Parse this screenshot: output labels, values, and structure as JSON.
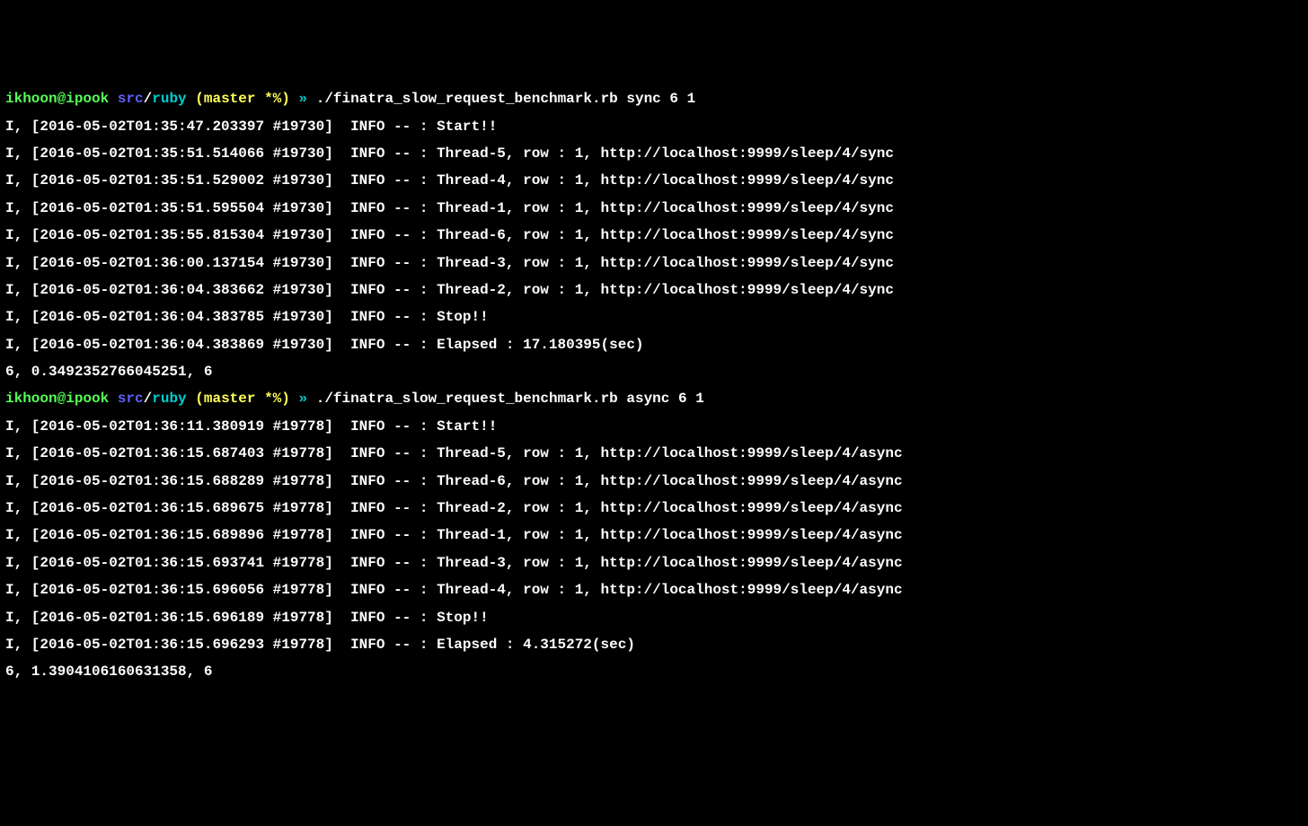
{
  "runs": [
    {
      "prompt": {
        "userhost": "ikhoon@ipook",
        "path_src": "src",
        "slash": "/",
        "path_ruby": "ruby",
        "branch": "(master *%)",
        "chevron": "»",
        "command": "./finatra_slow_request_benchmark.rb sync 6 1"
      },
      "lines": [
        "I, [2016-05-02T01:35:47.203397 #19730]  INFO -- : Start!!",
        "I, [2016-05-02T01:35:51.514066 #19730]  INFO -- : Thread-5, row : 1, http://localhost:9999/sleep/4/sync",
        "I, [2016-05-02T01:35:51.529002 #19730]  INFO -- : Thread-4, row : 1, http://localhost:9999/sleep/4/sync",
        "I, [2016-05-02T01:35:51.595504 #19730]  INFO -- : Thread-1, row : 1, http://localhost:9999/sleep/4/sync",
        "I, [2016-05-02T01:35:55.815304 #19730]  INFO -- : Thread-6, row : 1, http://localhost:9999/sleep/4/sync",
        "I, [2016-05-02T01:36:00.137154 #19730]  INFO -- : Thread-3, row : 1, http://localhost:9999/sleep/4/sync",
        "I, [2016-05-02T01:36:04.383662 #19730]  INFO -- : Thread-2, row : 1, http://localhost:9999/sleep/4/sync",
        "I, [2016-05-02T01:36:04.383785 #19730]  INFO -- : Stop!!",
        "I, [2016-05-02T01:36:04.383869 #19730]  INFO -- : Elapsed : 17.180395(sec)",
        "6, 0.3492352766045251, 6"
      ]
    },
    {
      "prompt": {
        "userhost": "ikhoon@ipook",
        "path_src": "src",
        "slash": "/",
        "path_ruby": "ruby",
        "branch": "(master *%)",
        "chevron": "»",
        "command": "./finatra_slow_request_benchmark.rb async 6 1"
      },
      "lines": [
        "I, [2016-05-02T01:36:11.380919 #19778]  INFO -- : Start!!",
        "I, [2016-05-02T01:36:15.687403 #19778]  INFO -- : Thread-5, row : 1, http://localhost:9999/sleep/4/async",
        "I, [2016-05-02T01:36:15.688289 #19778]  INFO -- : Thread-6, row : 1, http://localhost:9999/sleep/4/async",
        "I, [2016-05-02T01:36:15.689675 #19778]  INFO -- : Thread-2, row : 1, http://localhost:9999/sleep/4/async",
        "I, [2016-05-02T01:36:15.689896 #19778]  INFO -- : Thread-1, row : 1, http://localhost:9999/sleep/4/async",
        "I, [2016-05-02T01:36:15.693741 #19778]  INFO -- : Thread-3, row : 1, http://localhost:9999/sleep/4/async",
        "I, [2016-05-02T01:36:15.696056 #19778]  INFO -- : Thread-4, row : 1, http://localhost:9999/sleep/4/async",
        "I, [2016-05-02T01:36:15.696189 #19778]  INFO -- : Stop!!",
        "I, [2016-05-02T01:36:15.696293 #19778]  INFO -- : Elapsed : 4.315272(sec)",
        "6, 1.3904106160631358, 6"
      ]
    }
  ]
}
